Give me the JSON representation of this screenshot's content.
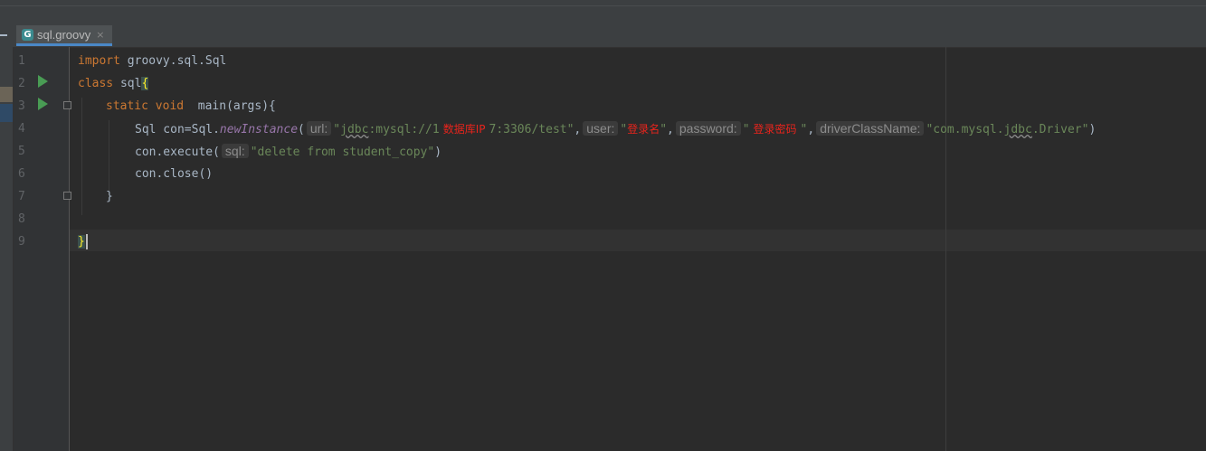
{
  "tab": {
    "file_name": "sql.groovy",
    "icon_letter": "G",
    "close_glyph": "×"
  },
  "line_numbers": [
    "1",
    "2",
    "3",
    "4",
    "5",
    "6",
    "7",
    "8",
    "9"
  ],
  "code": {
    "l1_kw": "import",
    "l1_rest": " groovy.sql.Sql",
    "l2_kw": "class",
    "l2_name": " sql",
    "l2_brace": "{",
    "l3_kw1": "static",
    "l3_kw2": " void",
    "l3_rest": "  main(args){",
    "l4_pre": "Sql con=Sql.",
    "l4_method": "newInstance",
    "l4_paren": "(",
    "l4_hint_url": "url:",
    "l4_url_open": "\"",
    "l4_url_jdbc": "jdbc",
    "l4_url_a": ":mysql://1",
    "l4_url_label": "数据库IP",
    "l4_url_b": "7:3306/test\"",
    "l4_comma1": ",",
    "l4_hint_user": "user:",
    "l4_user_q": "\"",
    "l4_user_label": "登录名",
    "l4_user_end": "\"",
    "l4_comma2": ",",
    "l4_hint_pw": "password:",
    "l4_pw_q": "\"",
    "l4_pw_label": "登录密码",
    "l4_pw_end": "\"",
    "l4_comma3": ",",
    "l4_hint_driver": "driverClassName:",
    "l4_drv_a": "\"com.mysql.",
    "l4_drv_jdbc": "jdbc",
    "l4_drv_b": ".Driver\"",
    "l4_close": ")",
    "l5_pre": "con.execute(",
    "l5_hint": "sql:",
    "l5_str": "\"delete from student_copy\"",
    "l5_close": ")",
    "l6": "con.close()",
    "l7": "}",
    "l9": "}"
  },
  "colors": {
    "keyword": "#cc7832",
    "string": "#6a8759",
    "method_static": "#9876aa",
    "annotation_red": "#e8241c",
    "run_icon": "#499c54",
    "tab_underline": "#4a88c7"
  },
  "icons": [
    "groovy-file-icon",
    "close-icon",
    "run-icon",
    "fold-icon"
  ]
}
